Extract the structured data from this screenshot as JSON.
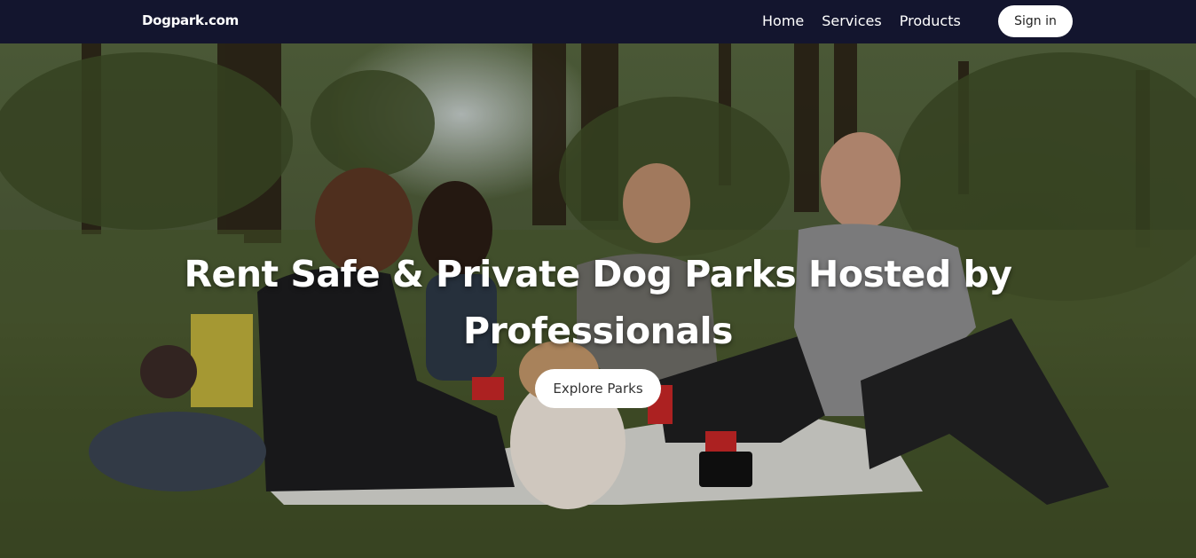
{
  "nav": {
    "brand": "Dogpark.com",
    "links": [
      {
        "label": "Home"
      },
      {
        "label": "Services"
      },
      {
        "label": "Products"
      }
    ],
    "signin_label": "Sign in"
  },
  "hero": {
    "headline": "Rent Safe & Private Dog Parks Hosted by Professionals",
    "cta_label": "Explore Parks"
  }
}
